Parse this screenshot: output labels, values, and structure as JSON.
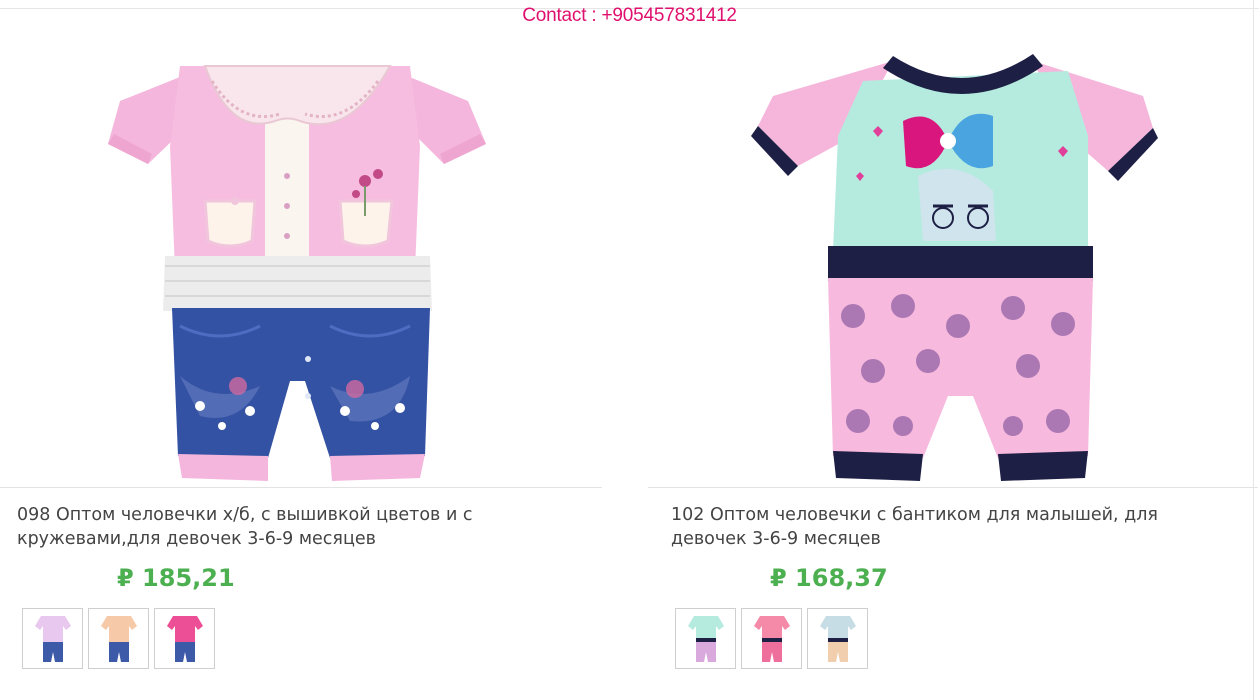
{
  "header": {
    "contact": "Contact : +905457831412"
  },
  "products": [
    {
      "title": "098 Оптом человечки х/б, с вышивкой цветов и с кружевами,для девочек 3-6-9 месяцев",
      "price": "₽ 185,21",
      "image_icon": "baby-romper-pink-denim-icon",
      "thumbnails": [
        "romper-lilac-variant-icon",
        "romper-peach-variant-icon",
        "romper-hotpink-variant-icon"
      ]
    },
    {
      "title": "102 Оптом человечки с бантиком для малышей, для девочек 3-6-9 месяцев",
      "price": "₽ 168,37",
      "image_icon": "baby-romper-pink-navy-bow-icon",
      "thumbnails": [
        "romper-mint-variant-icon",
        "romper-coral-variant-icon",
        "romper-beige-variant-icon"
      ]
    }
  ],
  "colors": {
    "contact": "#e0106e",
    "price": "#4caf50",
    "text": "#444444"
  }
}
